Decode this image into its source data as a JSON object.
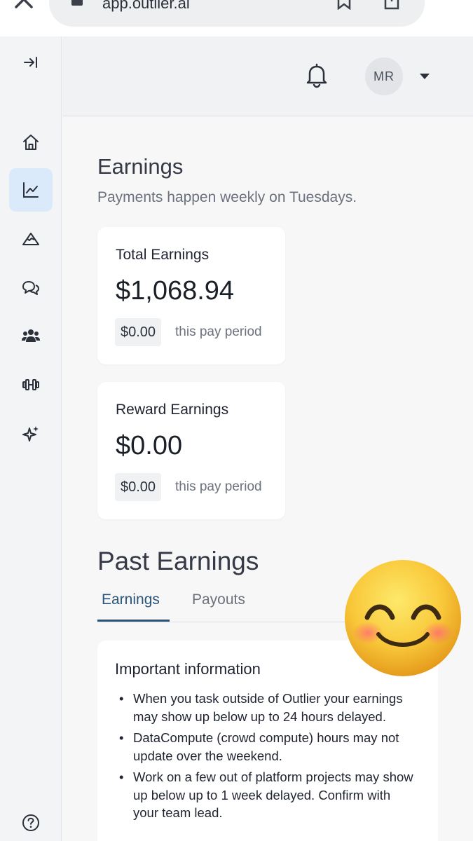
{
  "browser": {
    "url": "app.outlier.ai",
    "icons": [
      "close-icon",
      "lock-icon",
      "bookmark-icon",
      "share-icon",
      "more-icon"
    ]
  },
  "sidebar": {
    "items": [
      {
        "name": "collapse",
        "icon": "collapse-right-icon"
      },
      {
        "name": "home",
        "icon": "home-icon"
      },
      {
        "name": "earnings",
        "icon": "chart-line-icon",
        "active": true
      },
      {
        "name": "projects",
        "icon": "mountain-icon"
      },
      {
        "name": "community",
        "icon": "chat-bubbles-icon"
      },
      {
        "name": "teams",
        "icon": "users-icon"
      },
      {
        "name": "training",
        "icon": "dumbbell-icon"
      },
      {
        "name": "ai",
        "icon": "sparkles-icon"
      },
      {
        "name": "help",
        "icon": "help-circle-icon"
      }
    ]
  },
  "header": {
    "avatar_initials": "MR",
    "icons": [
      "bell-icon",
      "caret-down-icon"
    ]
  },
  "main": {
    "title": "Earnings",
    "subtitle": "Payments happen weekly on Tuesdays.",
    "cards": [
      {
        "label": "Total Earnings",
        "amount": "$1,068.94",
        "period_amount": "$0.00",
        "period_text": "this pay period"
      },
      {
        "label": "Reward Earnings",
        "amount": "$0.00",
        "period_amount": "$0.00",
        "period_text": "this pay period"
      }
    ],
    "past_title": "Past Earnings",
    "tabs": [
      {
        "label": "Earnings",
        "active": true
      },
      {
        "label": "Payouts",
        "active": false
      }
    ],
    "info": {
      "title": "Important information",
      "items": [
        "When you task outside of Outlier your earnings may show up below up to 24 hours delayed.",
        "DataCompute (crowd compute) hours may not update over the weekend.",
        "Work on a few out of platform projects may show up below up to 1 week delayed. Confirm with your team lead."
      ]
    }
  },
  "overlay": {
    "icon": "smiling-face-emoji-icon"
  },
  "colors": {
    "accent": "#2a5578",
    "active_nav_bg": "#dbeafb",
    "page_bg": "#f7f7f8",
    "card_bg": "#ffffff",
    "muted_text": "#6b717d"
  }
}
